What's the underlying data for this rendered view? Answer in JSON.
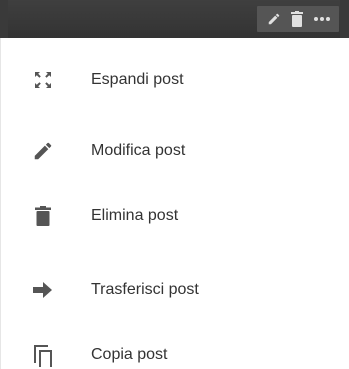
{
  "toolbar": {
    "icons": [
      "pencil-icon",
      "trash-icon",
      "more-icon"
    ]
  },
  "menu": {
    "items": [
      {
        "label": "Espandi post",
        "icon": "expand-icon"
      },
      {
        "label": "Modifica post",
        "icon": "pencil-icon"
      },
      {
        "label": "Elimina post",
        "icon": "trash-icon"
      },
      {
        "label": "Trasferisci post",
        "icon": "arrow-right-icon"
      },
      {
        "label": "Copia post",
        "icon": "copy-icon"
      }
    ]
  },
  "colors": {
    "toolbar_bg": "#3a3a3a",
    "icon": "#555555",
    "text": "#333333"
  }
}
